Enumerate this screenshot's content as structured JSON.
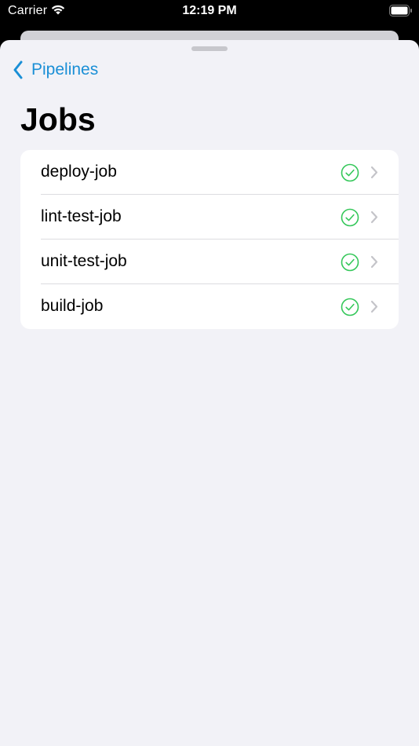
{
  "status_bar": {
    "carrier": "Carrier",
    "time": "12:19 PM",
    "wifi_icon": "wifi-icon",
    "battery_icon": "battery-icon"
  },
  "nav": {
    "back_label": "Pipelines",
    "back_icon": "chevron-left-icon"
  },
  "page": {
    "title": "Jobs"
  },
  "jobs": [
    {
      "name": "deploy-job",
      "status": "success"
    },
    {
      "name": "lint-test-job",
      "status": "success"
    },
    {
      "name": "unit-test-job",
      "status": "success"
    },
    {
      "name": "build-job",
      "status": "success"
    }
  ],
  "colors": {
    "accent": "#1a8fd6",
    "success": "#34c759",
    "background": "#f2f2f7"
  }
}
